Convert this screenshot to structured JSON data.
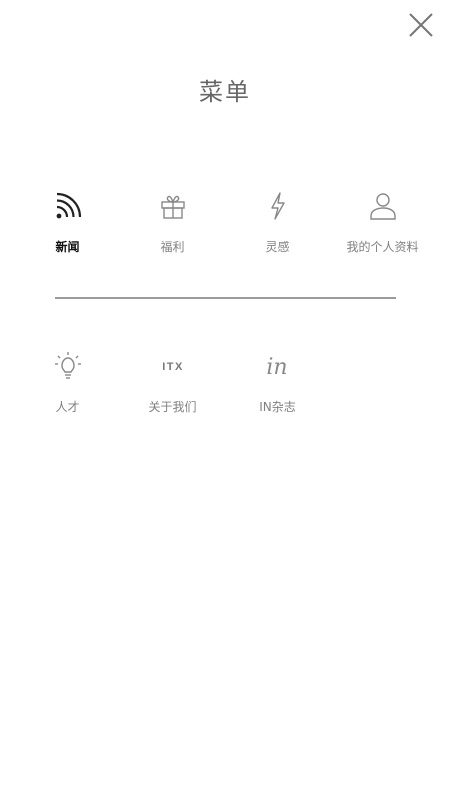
{
  "header": {
    "title": "菜单"
  },
  "menu": {
    "row1": [
      {
        "label": "新闻",
        "icon": "rss-icon",
        "active": true
      },
      {
        "label": "福利",
        "icon": "gift-icon",
        "active": false
      },
      {
        "label": "灵感",
        "icon": "lightning-icon",
        "active": false
      },
      {
        "label": "我的个人资料",
        "icon": "user-icon",
        "active": false
      }
    ],
    "row2": [
      {
        "label": "人才",
        "icon": "lightbulb-icon",
        "active": false
      },
      {
        "label": "关于我们",
        "icon": "itx-logo-icon",
        "active": false,
        "logo_text": "ITX"
      },
      {
        "label": "IN杂志",
        "icon": "in-logo-icon",
        "active": false,
        "logo_text": "in"
      }
    ]
  },
  "colors": {
    "active_label": "#111111",
    "inactive_label": "#808080",
    "icon_stroke": "#888888",
    "active_icon": "#222222",
    "divider": "#9a9a9a"
  }
}
